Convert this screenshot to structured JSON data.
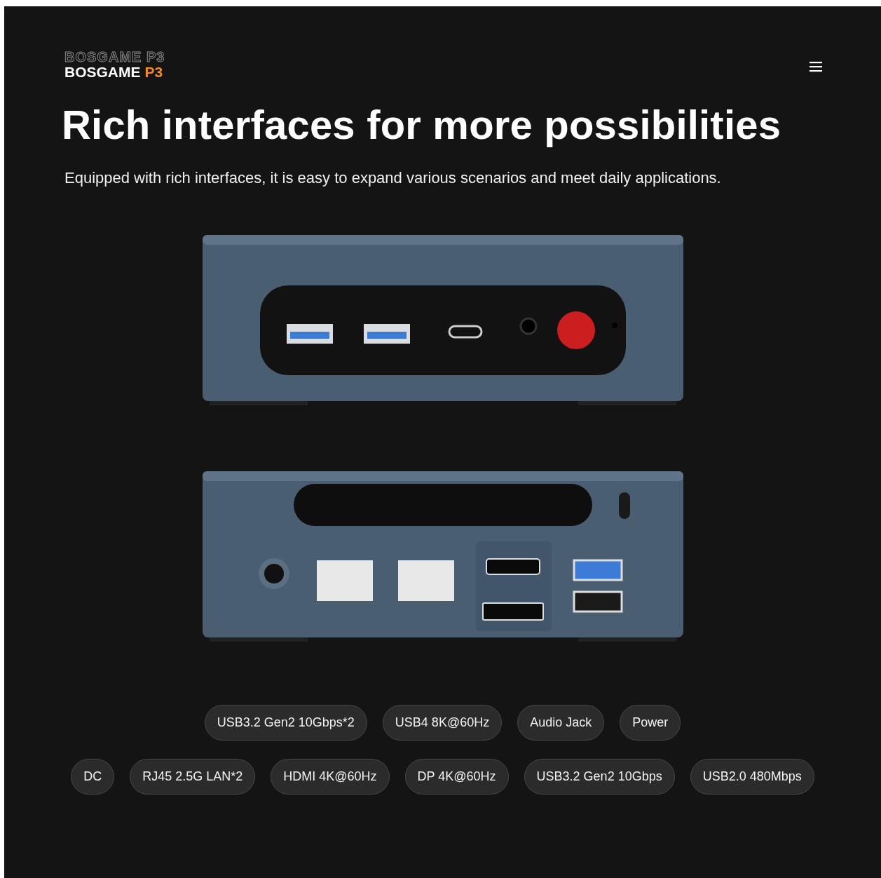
{
  "header": {
    "logo": {
      "ghost_text": "BOSGAME P3",
      "brand": "BOSGAME",
      "model": "P3"
    }
  },
  "hero": {
    "title": "Rich interfaces for more possibilities",
    "subtitle": "Equipped with rich interfaces, it is easy to expand various scenarios and meet daily applications."
  },
  "feature_rows": [
    [
      "USB3.2 Gen2 10Gbps*2",
      "USB4 8K@60Hz",
      "Audio Jack",
      "Power"
    ],
    [
      "DC",
      "RJ45 2.5G LAN*2",
      "HDMI 4K@60Hz",
      "DP 4K@60Hz",
      "USB3.2 Gen2 10Gbps",
      "USB2.0 480Mbps"
    ]
  ]
}
